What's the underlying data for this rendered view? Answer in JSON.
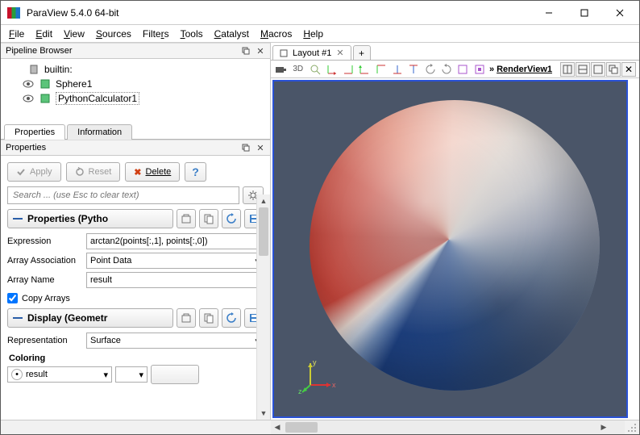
{
  "window": {
    "title": "ParaView 5.4.0 64-bit"
  },
  "menu": {
    "file": "File",
    "edit": "Edit",
    "view": "View",
    "sources": "Sources",
    "filters": "Filters",
    "tools": "Tools",
    "catalyst": "Catalyst",
    "macros": "Macros",
    "help": "Help"
  },
  "pipeline": {
    "title": "Pipeline Browser",
    "items": [
      {
        "name": "builtin:",
        "icon": "server",
        "visible": false
      },
      {
        "name": "Sphere1",
        "icon": "source",
        "visible": true
      },
      {
        "name": "PythonCalculator1",
        "icon": "filter",
        "visible": true,
        "selected": true
      }
    ]
  },
  "tabs": {
    "properties": "Properties",
    "information": "Information"
  },
  "properties": {
    "title": "Properties",
    "apply": "Apply",
    "reset": "Reset",
    "delete": "Delete",
    "search_placeholder": "Search ... (use Esc to clear text)",
    "section1": "Properties (Pytho",
    "expression_label": "Expression",
    "expression_value": "arctan2(points[:,1], points[:,0])",
    "assoc_label": "Array Association",
    "assoc_value": "Point Data",
    "arrayname_label": "Array Name",
    "arrayname_value": "result",
    "copy_arrays": "Copy Arrays",
    "section2": "Display (Geometr",
    "repr_label": "Representation",
    "repr_value": "Surface",
    "coloring_label": "Coloring",
    "coloring_field": "result"
  },
  "layout": {
    "tab": "Layout #1",
    "mode3d": "3D",
    "renderview": "RenderView1"
  }
}
